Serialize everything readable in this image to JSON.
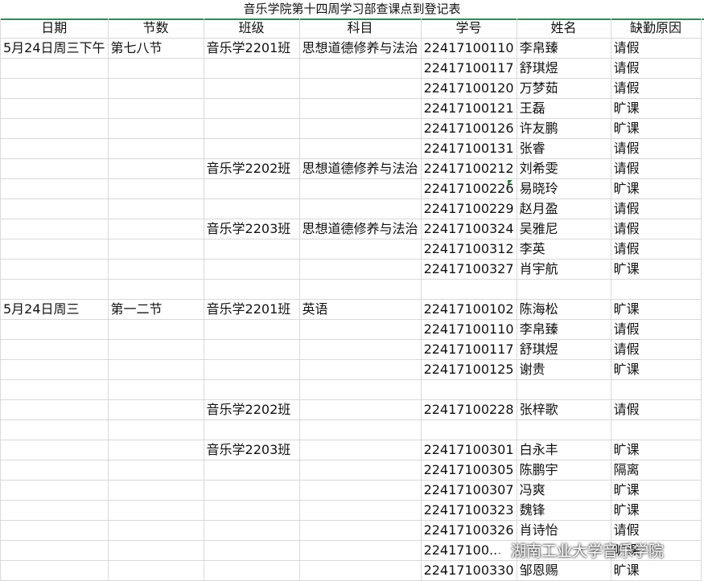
{
  "sheet": {
    "title": "音乐学院第十四周学习部查课点到登记表",
    "headers": [
      "日期",
      "节数",
      "班级",
      "科目",
      "学号",
      "姓名",
      "缺勤原因"
    ],
    "rows": [
      [
        "5月24日周三下午",
        "第七八节",
        "音乐学2201班",
        "思想道德修养与法治",
        "22417100110",
        "李帛臻",
        "请假"
      ],
      [
        "",
        "",
        "",
        "",
        "22417100117",
        "舒琪煜",
        "请假"
      ],
      [
        "",
        "",
        "",
        "",
        "22417100120",
        "万梦茹",
        "请假"
      ],
      [
        "",
        "",
        "",
        "",
        "22417100121",
        "王磊",
        "旷课"
      ],
      [
        "",
        "",
        "",
        "",
        "22417100126",
        "许友鹏",
        "旷课"
      ],
      [
        "",
        "",
        "",
        "",
        "22417100131",
        "张睿",
        "请假"
      ],
      [
        "",
        "",
        "音乐学2202班",
        "思想道德修养与法治",
        "22417100212",
        "刘希雯",
        "请假"
      ],
      [
        "",
        "",
        "",
        "",
        "22417100226",
        " 易晓玲",
        "旷课"
      ],
      [
        "",
        "",
        "",
        "",
        "22417100229",
        "赵月盈",
        "请假"
      ],
      [
        "",
        "",
        "音乐学2203班",
        "思想道德修养与法治",
        "22417100324",
        "吴雅尼",
        "请假"
      ],
      [
        "",
        "",
        "",
        "",
        "22417100312",
        "李英",
        "请假"
      ],
      [
        "",
        "",
        "",
        "",
        "22417100327",
        "肖宇航",
        "旷课"
      ],
      [
        "",
        "",
        "",
        "",
        "",
        "",
        ""
      ],
      [
        "5月24日周三",
        "第一二节",
        "音乐学2201班",
        "英语",
        "22417100102",
        "陈海松",
        "旷课"
      ],
      [
        "",
        "",
        "",
        "",
        "22417100110",
        "李帛臻",
        "请假"
      ],
      [
        "",
        "",
        "",
        "",
        "22417100117",
        "舒琪煜",
        "请假"
      ],
      [
        "",
        "",
        "",
        "",
        "22417100125",
        "谢贵",
        "旷课"
      ],
      [
        "",
        "",
        "",
        "",
        "",
        "",
        ""
      ],
      [
        "",
        "",
        "音乐学2202班",
        "",
        "22417100228",
        "张梓歌",
        "请假"
      ],
      [
        "",
        "",
        "",
        "",
        "",
        "",
        ""
      ],
      [
        "",
        "",
        "音乐学2203班",
        "",
        "22417100301",
        "白永丰",
        "旷课"
      ],
      [
        "",
        "",
        "",
        "",
        "22417100305",
        "陈鹏宇",
        "隔离"
      ],
      [
        "",
        "",
        "",
        "",
        "22417100307",
        "冯爽",
        "旷课"
      ],
      [
        "",
        "",
        "",
        "",
        "22417100323",
        "魏锋",
        "旷课"
      ],
      [
        "",
        "",
        "",
        "",
        "22417100326",
        "肖诗怡",
        "请假"
      ],
      [
        "",
        "",
        "",
        "",
        "22417100...",
        "",
        "旷课"
      ],
      [
        "",
        "",
        "",
        "",
        "22417100330",
        "邹恩赐",
        "旷课"
      ]
    ]
  },
  "watermark": {
    "icon": "wechat-icon",
    "text": "湖南工业大学音乐学院"
  }
}
